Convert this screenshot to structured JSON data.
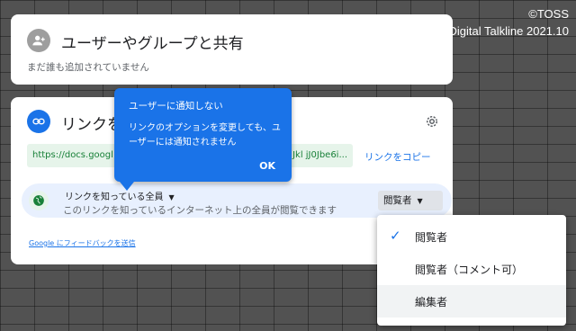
{
  "watermark": {
    "line1": "©TOSS",
    "line2": "Digital Talkline 2021.10"
  },
  "share_card": {
    "title": "ユーザーやグループと共有",
    "subtitle": "まだ誰も追加されていません",
    "icon": "add-person-icon"
  },
  "link_card": {
    "title": "リンクを",
    "icon": "link-icon",
    "url_start": "https://docs.googl",
    "url_end": "Jkl jJ0Jbe6i...",
    "copy_label": "リンクをコピー",
    "access": {
      "title": "リンクを知っている全員",
      "description": "このリンクを知っているインターネット上の全員が閲覧できます",
      "role": "閲覧者"
    },
    "feedback": "Google にフィードバックを送信"
  },
  "tooltip": {
    "title": "ユーザーに通知しない",
    "body": "リンクのオプションを変更しても、ユーザーには通知されません",
    "ok": "OK"
  },
  "role_menu": {
    "items": [
      {
        "label": "閲覧者",
        "checked": true
      },
      {
        "label": "閲覧者（コメント可）",
        "checked": false
      },
      {
        "label": "編集者",
        "checked": false
      }
    ]
  },
  "colors": {
    "accent": "#1a73e8",
    "url_text": "#188038",
    "url_bg": "#e6f4ea"
  }
}
